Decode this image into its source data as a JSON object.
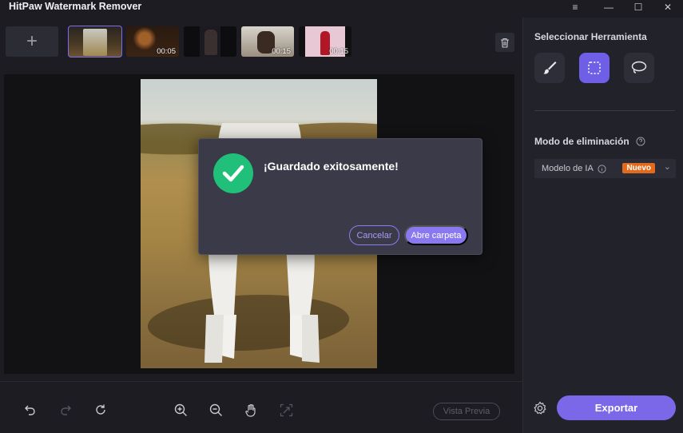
{
  "app": {
    "title": "HitPaw Watermark Remover"
  },
  "window_controls": {
    "menu": "≡",
    "minimize": "—",
    "maximize": "☐",
    "close": "✕"
  },
  "media_strip": {
    "add_label": "+",
    "thumbnails": [
      {
        "duration": "",
        "selected": true
      },
      {
        "duration": "00:05",
        "selected": false
      },
      {
        "duration": "",
        "selected": false
      },
      {
        "duration": "00:15",
        "selected": false
      },
      {
        "duration": "00:15",
        "selected": false
      }
    ]
  },
  "dialog": {
    "message": "¡Guardado exitosamente!",
    "cancel_label": "Cancelar",
    "open_label": "Abre carpeta"
  },
  "bottom_toolbar": {
    "preview_label": "Vista Previa"
  },
  "right_panel": {
    "tools_heading": "Seleccionar Herramienta",
    "mode_heading": "Modo de eliminación",
    "mode_select": {
      "value": "Modelo de IA",
      "badge": "Nuevo"
    },
    "export_label": "Exportar"
  },
  "colors": {
    "accent": "#7a68e8",
    "success": "#20c07a",
    "badge": "#e36a1b"
  }
}
